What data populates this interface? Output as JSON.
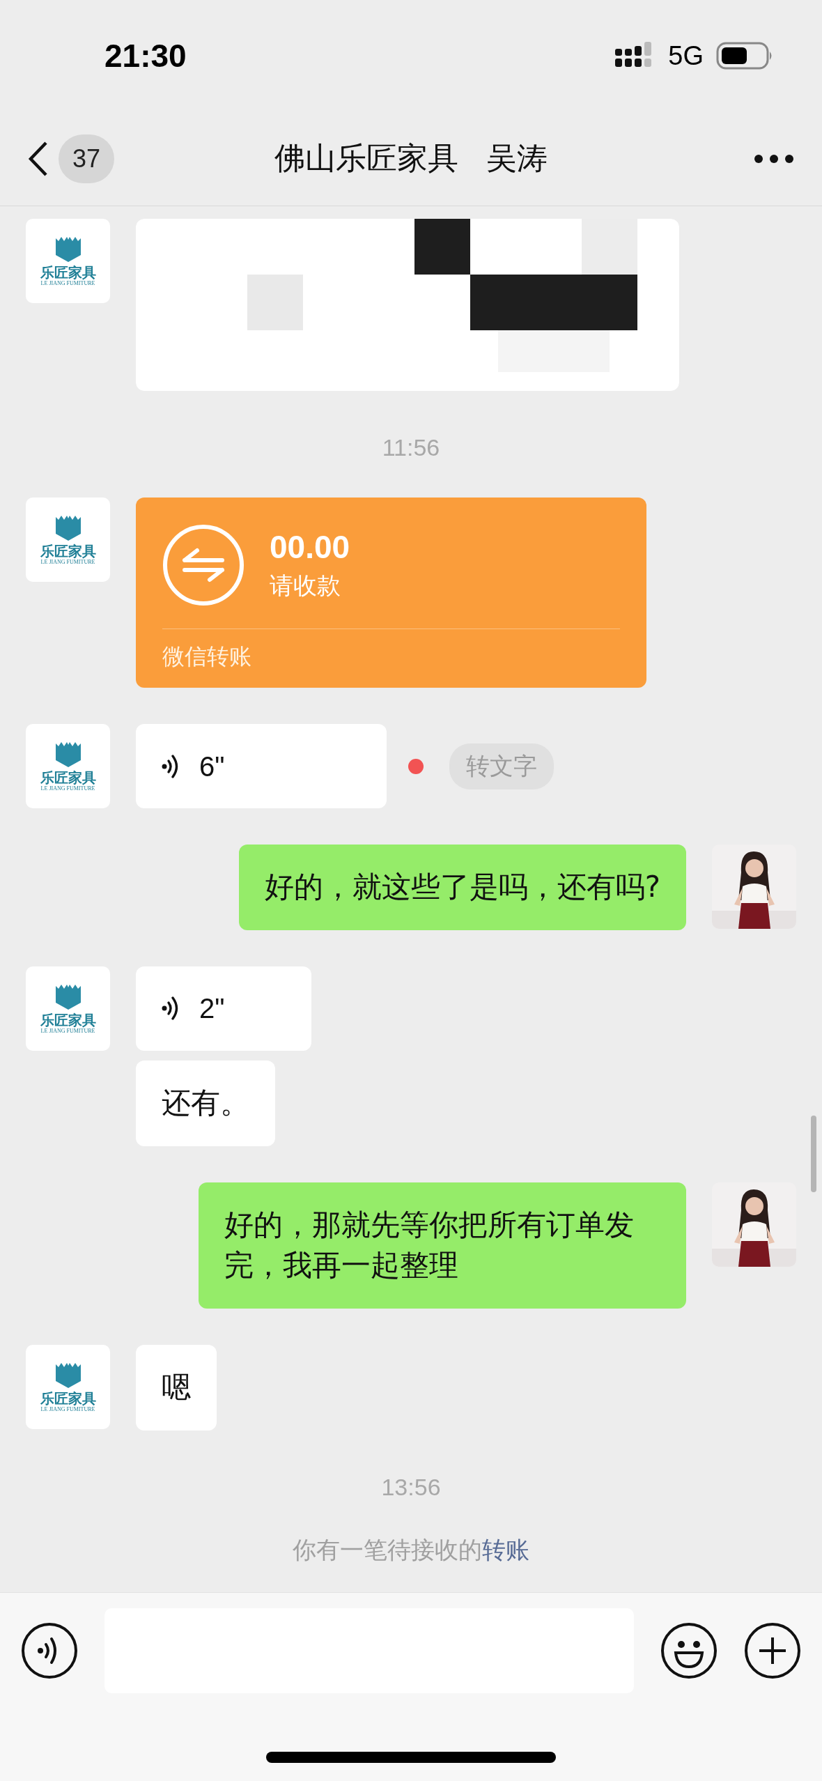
{
  "status_bar": {
    "time": "21:30",
    "network": "5G"
  },
  "header": {
    "unread": "37",
    "title": "佛山乐匠家具",
    "subtitle": "吴涛"
  },
  "messages": [
    {
      "kind": "redacted",
      "outgoing": false,
      "avatar": {
        "kind": "logo",
        "name": "乐匠家具",
        "subtitle": "LE JIANG FUMITURE"
      }
    },
    {
      "kind": "time",
      "text": "11:56"
    },
    {
      "kind": "transfer",
      "outgoing": false,
      "avatar": {
        "kind": "logo",
        "name": "乐匠家具",
        "subtitle": "LE JIANG FUMITURE"
      },
      "amount": "00.00",
      "caption": "请收款",
      "footer": "微信转账"
    },
    {
      "kind": "voice",
      "outgoing": false,
      "avatar": {
        "kind": "logo",
        "name": "乐匠家具",
        "subtitle": "LE JIANG FUMITURE"
      },
      "duration": "6\"",
      "unread": true,
      "action": "转文字"
    },
    {
      "kind": "text",
      "outgoing": true,
      "text": "好的，就这些了是吗，还有吗?"
    },
    {
      "kind": "voice",
      "outgoing": false,
      "avatar": {
        "kind": "logo",
        "name": "乐匠家具",
        "subtitle": "LE JIANG FUMITURE"
      },
      "duration": "2\"",
      "unread": false
    },
    {
      "kind": "text",
      "outgoing": false,
      "text": "还有。"
    },
    {
      "kind": "text",
      "outgoing": true,
      "text": "好的，那就先等你把所有订单发完，我再一起整理"
    },
    {
      "kind": "text",
      "outgoing": false,
      "avatar": {
        "kind": "logo",
        "name": "乐匠家具",
        "subtitle": "LE JIANG FUMITURE"
      },
      "text": "嗯"
    },
    {
      "kind": "time",
      "text": "13:56"
    },
    {
      "kind": "notice",
      "text": "你有一笔待接收的",
      "link": "转账"
    }
  ]
}
